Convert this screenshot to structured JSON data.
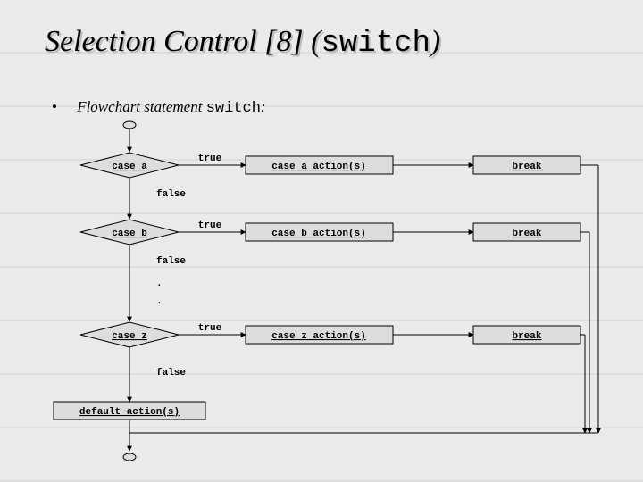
{
  "title": {
    "pre": "Selection Control [8] (",
    "code": "switch",
    "post": ")"
  },
  "bullet": {
    "pre": "Flowchart statement ",
    "code": "switch",
    "post": ":"
  },
  "labels": {
    "true": "true",
    "false": "false",
    "break": "break"
  },
  "cases": {
    "a": {
      "diamond": "case a",
      "action": "case a action(s)"
    },
    "b": {
      "diamond": "case b",
      "action": "case b action(s)"
    },
    "z": {
      "diamond": "case z",
      "action": "case z action(s)"
    }
  },
  "default_action": "default action(s)",
  "ellipsis": {
    "d1": ".",
    "d2": "."
  }
}
